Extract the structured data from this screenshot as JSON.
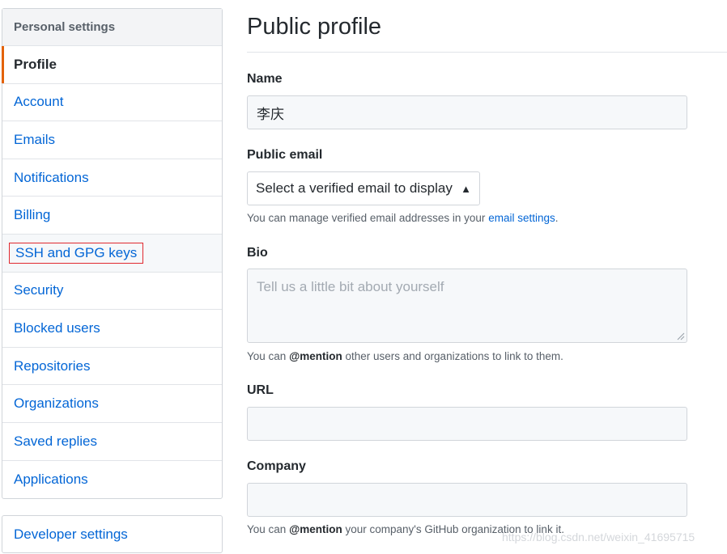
{
  "sidebar": {
    "header": "Personal settings",
    "items": [
      {
        "label": "Profile"
      },
      {
        "label": "Account"
      },
      {
        "label": "Emails"
      },
      {
        "label": "Notifications"
      },
      {
        "label": "Billing"
      },
      {
        "label": "SSH and GPG keys"
      },
      {
        "label": "Security"
      },
      {
        "label": "Blocked users"
      },
      {
        "label": "Repositories"
      },
      {
        "label": "Organizations"
      },
      {
        "label": "Saved replies"
      },
      {
        "label": "Applications"
      }
    ],
    "developer_settings": "Developer settings"
  },
  "main": {
    "title": "Public profile",
    "name_label": "Name",
    "name_value": "李庆",
    "public_email_label": "Public email",
    "public_email_select": "Select a verified email to display",
    "public_email_note_prefix": "You can manage verified email addresses in your ",
    "public_email_note_link": "email settings",
    "public_email_note_suffix": ".",
    "bio_label": "Bio",
    "bio_placeholder": "Tell us a little bit about yourself",
    "bio_note_prefix": "You can ",
    "bio_note_mention": "@mention",
    "bio_note_suffix": " other users and organizations to link to them.",
    "url_label": "URL",
    "url_value": "",
    "company_label": "Company",
    "company_value": "",
    "company_note_prefix": "You can ",
    "company_note_mention": "@mention",
    "company_note_suffix": " your company's GitHub organization to link it."
  },
  "watermark": "https://blog.csdn.net/weixin_41695715",
  "colors": {
    "link": "#0366d6",
    "selected_indicator": "#e36209",
    "highlight_box": "#e0292f"
  }
}
